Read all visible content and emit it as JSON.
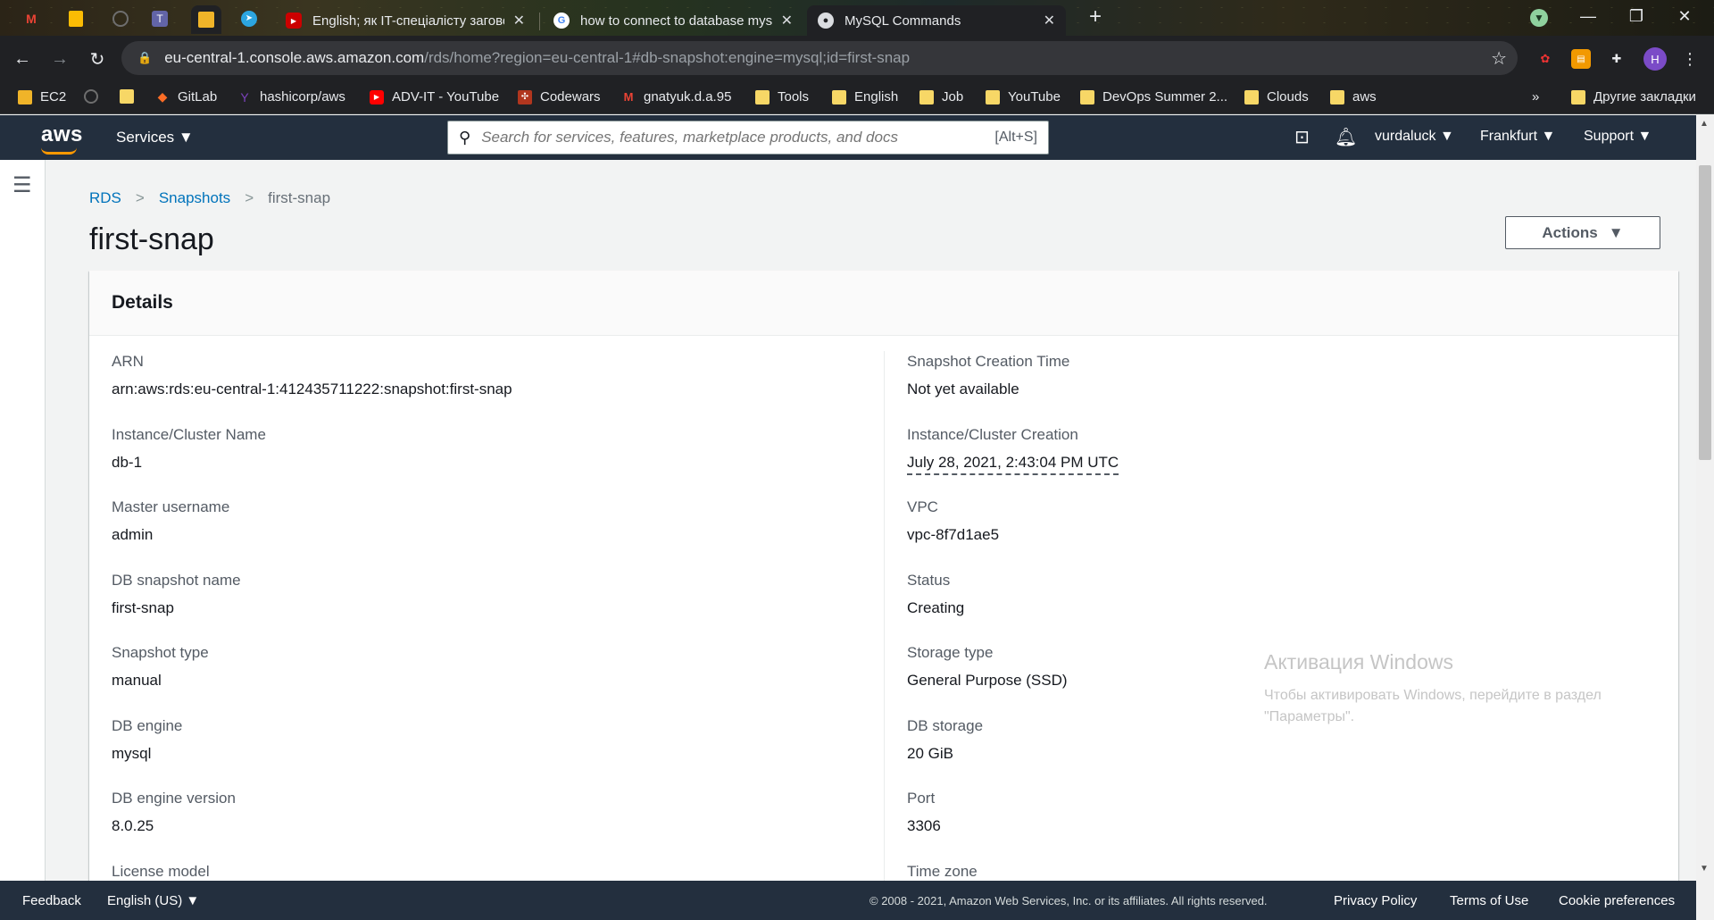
{
  "browser": {
    "tabs": [
      {
        "title": "English; як IT-спеціалісту заговорити англійською",
        "active": false
      },
      {
        "title": "how to connect to database mysql",
        "active": false
      },
      {
        "title": "MySQL Commands",
        "active": true
      }
    ],
    "url_host": "eu-central-1.console.aws.amazon.com",
    "url_path": "/rds/home?region=eu-central-1#db-snapshot:engine=mysql;id=first-snap",
    "profile_initial": "H",
    "bookmarks": [
      "EC2",
      "GitLab",
      "hashicorp/aws",
      "ADV-IT - YouTube",
      "Codewars",
      "gnatyuk.d.a.95",
      "Tools",
      "English",
      "Job",
      "YouTube",
      "DevOps Summer 2...",
      "Clouds",
      "aws"
    ],
    "bookmarks_more": "»",
    "other_bookmarks": "Другие закладки"
  },
  "aws": {
    "logo": "aws",
    "services_label": "Services",
    "search_placeholder": "Search for services, features, marketplace products, and docs",
    "search_shortcut": "[Alt+S]",
    "user": "vurdaluck",
    "region": "Frankfurt",
    "support": "Support"
  },
  "breadcrumbs": {
    "rds": "RDS",
    "snapshots": "Snapshots",
    "current": "first-snap"
  },
  "page_title": "first-snap",
  "actions_label": "Actions",
  "details": {
    "heading": "Details",
    "left": [
      {
        "k": "ARN",
        "v": "arn:aws:rds:eu-central-1:412435711222:snapshot:first-snap"
      },
      {
        "k": "Instance/Cluster Name",
        "v": "db-1"
      },
      {
        "k": "Master username",
        "v": "admin"
      },
      {
        "k": "DB snapshot name",
        "v": "first-snap"
      },
      {
        "k": "Snapshot type",
        "v": "manual"
      },
      {
        "k": "DB engine",
        "v": "mysql"
      },
      {
        "k": "DB engine version",
        "v": "8.0.25"
      },
      {
        "k": "License model",
        "v": ""
      }
    ],
    "right": [
      {
        "k": "Snapshot Creation Time",
        "v": "Not yet available"
      },
      {
        "k": "Instance/Cluster Creation",
        "v": "July 28, 2021, 2:43:04 PM UTC"
      },
      {
        "k": "VPC",
        "v": "vpc-8f7d1ae5"
      },
      {
        "k": "Status",
        "v": "Creating"
      },
      {
        "k": "Storage type",
        "v": "General Purpose (SSD)"
      },
      {
        "k": "DB storage",
        "v": "20 GiB"
      },
      {
        "k": "Port",
        "v": "3306"
      },
      {
        "k": "Time zone",
        "v": ""
      }
    ]
  },
  "watermark": {
    "line1": "Активация Windows",
    "line2": "Чтобы активировать Windows, перейдите в раздел",
    "line3": "\"Параметры\"."
  },
  "footer": {
    "feedback": "Feedback",
    "language": "English (US)",
    "copyright": "© 2008 - 2021, Amazon Web Services, Inc. or its affiliates. All rights reserved.",
    "privacy": "Privacy Policy",
    "terms": "Terms of Use",
    "cookies": "Cookie preferences"
  },
  "colors": {
    "aws_nav": "#232f3e",
    "link": "#0073bb",
    "aws_orange": "#ff9900"
  }
}
